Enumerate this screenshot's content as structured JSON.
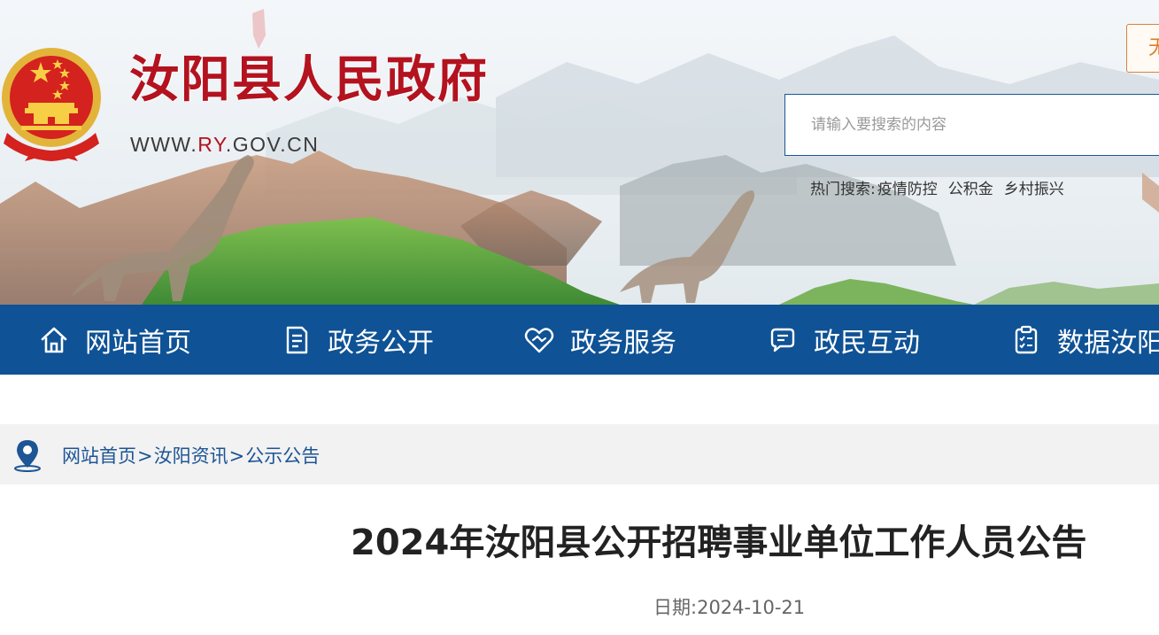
{
  "header": {
    "site_title": "汝阳县人民政府",
    "site_url_prefix": "WWW.",
    "site_url_highlight": "RY",
    "site_url_suffix": ".GOV.CN",
    "top_button_label": "无",
    "brand_color": "#b3121e"
  },
  "search": {
    "placeholder": "请输入要搜索的内容",
    "hot_label": "热门搜索:",
    "hot_keywords": [
      "疫情防控",
      "公积金",
      "乡村振兴"
    ]
  },
  "nav": {
    "background": "#0f5295",
    "items": [
      {
        "label": "网站首页",
        "icon": "home-icon"
      },
      {
        "label": "政务公开",
        "icon": "document-icon"
      },
      {
        "label": "政务服务",
        "icon": "handshake-heart-icon"
      },
      {
        "label": "政民互动",
        "icon": "chat-bubble-icon"
      },
      {
        "label": "数据汝阳",
        "icon": "clipboard-checklist-icon"
      }
    ]
  },
  "breadcrumb": {
    "icon": "location-pin-icon",
    "items": [
      "网站首页",
      "汝阳资讯",
      "公示公告"
    ],
    "separator": ">"
  },
  "article": {
    "title": "2024年汝阳县公开招聘事业单位工作人员公告",
    "date_label": "日期:",
    "date": "2024-10-21"
  }
}
